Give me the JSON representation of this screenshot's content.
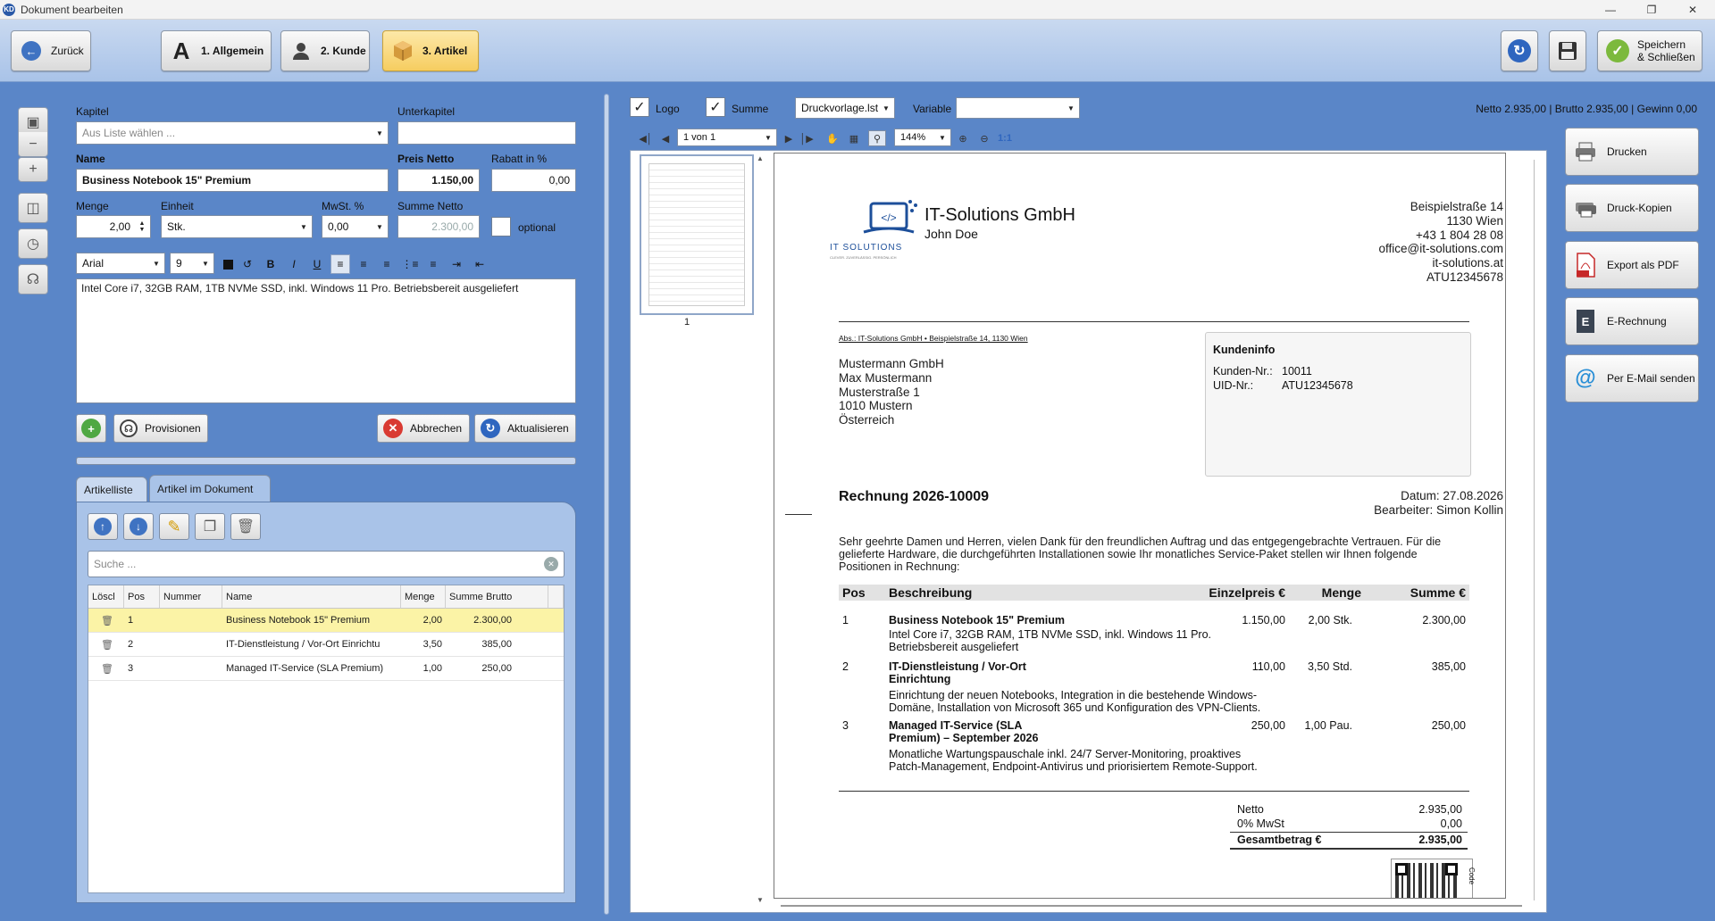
{
  "window": {
    "title": "Dokument bearbeiten",
    "app_badge": "KD"
  },
  "toolbar": {
    "back": "Zurück",
    "steps": [
      "1. Allgemein",
      "2. Kunde",
      "3. Artikel"
    ],
    "save_close": [
      "Speichern",
      "& Schließen"
    ]
  },
  "form": {
    "kapitel_label": "Kapitel",
    "kapitel_placeholder": "Aus Liste wählen ...",
    "unterkapitel_label": "Unterkapitel",
    "unterkapitel_value": "",
    "name_label": "Name",
    "name_value": "Business Notebook 15\" Premium",
    "preis_label": "Preis Netto",
    "preis_value": "1.150,00",
    "rabatt_label": "Rabatt in %",
    "rabatt_value": "0,00",
    "menge_label": "Menge",
    "menge_value": "2,00",
    "einheit_label": "Einheit",
    "einheit_value": "Stk.",
    "mwst_label": "MwSt. %",
    "mwst_value": "0,00",
    "summe_label": "Summe Netto",
    "summe_value": "2.300,00",
    "optional_label": "optional",
    "font_value": "Arial",
    "fontsize_value": "9",
    "description": "Intel Core i7, 32GB RAM, 1TB NVMe SSD, inkl. Windows 11 Pro. Betriebsbereit ausgeliefert",
    "btn_provisionen": "Provisionen",
    "btn_abbrechen": "Abbrechen",
    "btn_aktualisieren": "Aktualisieren"
  },
  "tabs": [
    "Artikelliste",
    "Artikel im Dokument"
  ],
  "search_placeholder": "Suche ...",
  "grid": {
    "headers": [
      "Löscl",
      "Pos",
      "Nummer",
      "Name",
      "Menge",
      "Summe Brutto"
    ],
    "rows": [
      {
        "pos": "1",
        "nummer": "",
        "name": "Business Notebook 15\" Premium",
        "menge": "2,00",
        "summe": "2.300,00",
        "selected": true
      },
      {
        "pos": "2",
        "nummer": "",
        "name": "IT-Dienstleistung / Vor-Ort Einrichtu",
        "menge": "3,50",
        "summe": "385,00",
        "selected": false
      },
      {
        "pos": "3",
        "nummer": "",
        "name": "Managed IT-Service (SLA Premium)",
        "menge": "1,00",
        "summe": "250,00",
        "selected": false
      }
    ]
  },
  "preview_bar": {
    "logo_label": "Logo",
    "summe_label": "Summe",
    "template": "Druckvorlage.lst",
    "variable_label": "Variable",
    "variable_value": "",
    "totals": "Netto 2.935,00 | Brutto 2.935,00 | Gewinn 0,00",
    "page_indicator": "1 von 1",
    "zoom": "144%",
    "zoom_reset": "1:1",
    "thumb_page": "1"
  },
  "side_buttons": [
    "Drucken",
    "Druck-Kopien",
    "Export als PDF",
    "E-Rechnung",
    "Per E-Mail senden"
  ],
  "invoice": {
    "company": "IT-Solutions GmbH",
    "contact": "John Doe",
    "logo_text": "IT SOLUTIONS",
    "logo_tagline": "CLEVER. ZUVERLÄSSIG. PERSÖNLICH",
    "sender_address": [
      "Beispielstraße 14",
      "1130 Wien",
      "+43 1 804 28 08",
      "office@it-solutions.com",
      "it-solutions.at",
      "ATU12345678"
    ],
    "sender_line": "Abs.: IT-Solutions GmbH • Beispielstraße 14, 1130 Wien",
    "recipient": [
      "Mustermann GmbH",
      "Max Mustermann",
      "Musterstraße 1",
      "1010 Mustern",
      "Österreich"
    ],
    "kundeninfo_title": "Kundeninfo",
    "kunden_nr_label": "Kunden-Nr.:",
    "kunden_nr": "10011",
    "uid_label": "UID-Nr.:",
    "uid": "ATU12345678",
    "title": "Rechnung 2026-10009",
    "datum": "Datum: 27.08.2026",
    "bearbeiter": "Bearbeiter: Simon Kollin",
    "intro": [
      "Sehr geehrte Damen und Herren, vielen Dank für den freundlichen Auftrag und das entgegengebrachte Vertrauen. Für die",
      "gelieferte Hardware, die durchgeführten Installationen sowie Ihr monatliches Service-Paket stellen wir Ihnen folgende",
      "Positionen in Rechnung:"
    ],
    "table_headers": [
      "Pos",
      "Beschreibung",
      "Einzelpreis €",
      "Menge",
      "Summe €"
    ],
    "items": [
      {
        "pos": "1",
        "title": [
          "Business Notebook 15\" Premium"
        ],
        "desc": [
          "Intel Core i7, 32GB RAM, 1TB NVMe SSD, inkl. Windows 11 Pro.",
          "Betriebsbereit ausgeliefert"
        ],
        "price": "1.150,00",
        "qty": "2,00 Stk.",
        "sum": "2.300,00"
      },
      {
        "pos": "2",
        "title": [
          "IT-Dienstleistung / Vor-Ort",
          "Einrichtung"
        ],
        "desc": [
          "Einrichtung der neuen Notebooks, Integration in die bestehende Windows-",
          "Domäne, Installation von Microsoft 365 und Konfiguration des VPN-Clients."
        ],
        "price": "110,00",
        "qty": "3,50 Std.",
        "sum": "385,00"
      },
      {
        "pos": "3",
        "title": [
          "Managed IT-Service (SLA",
          "Premium) – September 2026"
        ],
        "desc": [
          "Monatliche Wartungspauschale inkl. 24/7 Server-Monitoring, proaktives",
          "Patch-Management, Endpoint-Antivirus und priorisiertem Remote-Support."
        ],
        "price": "250,00",
        "qty": "1,00 Pau.",
        "sum": "250,00"
      }
    ],
    "netto_label": "Netto",
    "netto": "2.935,00",
    "mwst_label": "0% MwSt",
    "mwst": "0,00",
    "gesamt_label": "Gesamtbetrag €",
    "gesamt": "2.935,00",
    "qr_label": "Code"
  },
  "colors": {
    "toolbar": "#a9c3e8",
    "background": "#5a86c8",
    "selected_row": "#fbf3a6",
    "active_step": "#f6cd60"
  }
}
